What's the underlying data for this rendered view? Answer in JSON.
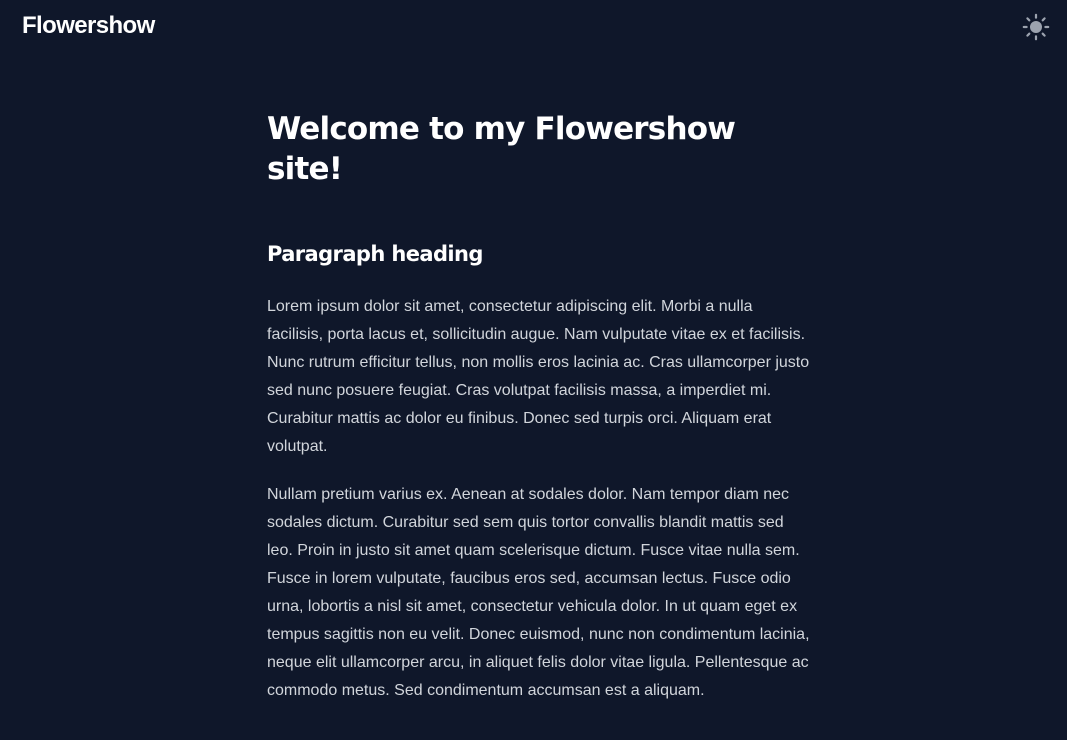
{
  "navbar": {
    "site_title": "Flowershow",
    "theme_toggle_icon": "sun-icon"
  },
  "article": {
    "title": "Welcome to my Flowershow site!",
    "heading": "Paragraph heading",
    "paragraphs": [
      "Lorem ipsum dolor sit amet, consectetur adipiscing elit. Morbi a nulla facilisis, porta lacus et, sollicitudin augue. Nam vulputate vitae ex et facilisis. Nunc rutrum efficitur tellus, non mollis eros lacinia ac. Cras ullamcorper justo sed nunc posuere feugiat. Cras volutpat facilisis massa, a imperdiet mi. Curabitur mattis ac dolor eu finibus. Donec sed turpis orci. Aliquam erat volutpat.",
      "Nullam pretium varius ex. Aenean at sodales dolor. Nam tempor diam nec sodales dictum. Curabitur sed sem quis tortor convallis blandit mattis sed leo. Proin in justo sit amet quam scelerisque dictum. Fusce vitae nulla sem. Fusce in lorem vulputate, faucibus eros sed, accumsan lectus. Fusce odio urna, lobortis a nisl sit amet, consectetur vehicula dolor. In ut quam eget ex tempus sagittis non eu velit. Donec euismod, nunc non condimentum lacinia, neque elit ullamcorper arcu, in aliquet felis dolor vitae ligula. Pellentesque ac commodo metus. Sed condimentum accumsan est a aliquam."
    ]
  },
  "colors": {
    "background": "#0f172a",
    "heading_text": "#ffffff",
    "body_text": "#d1d5db",
    "icon": "#9ca3af"
  }
}
